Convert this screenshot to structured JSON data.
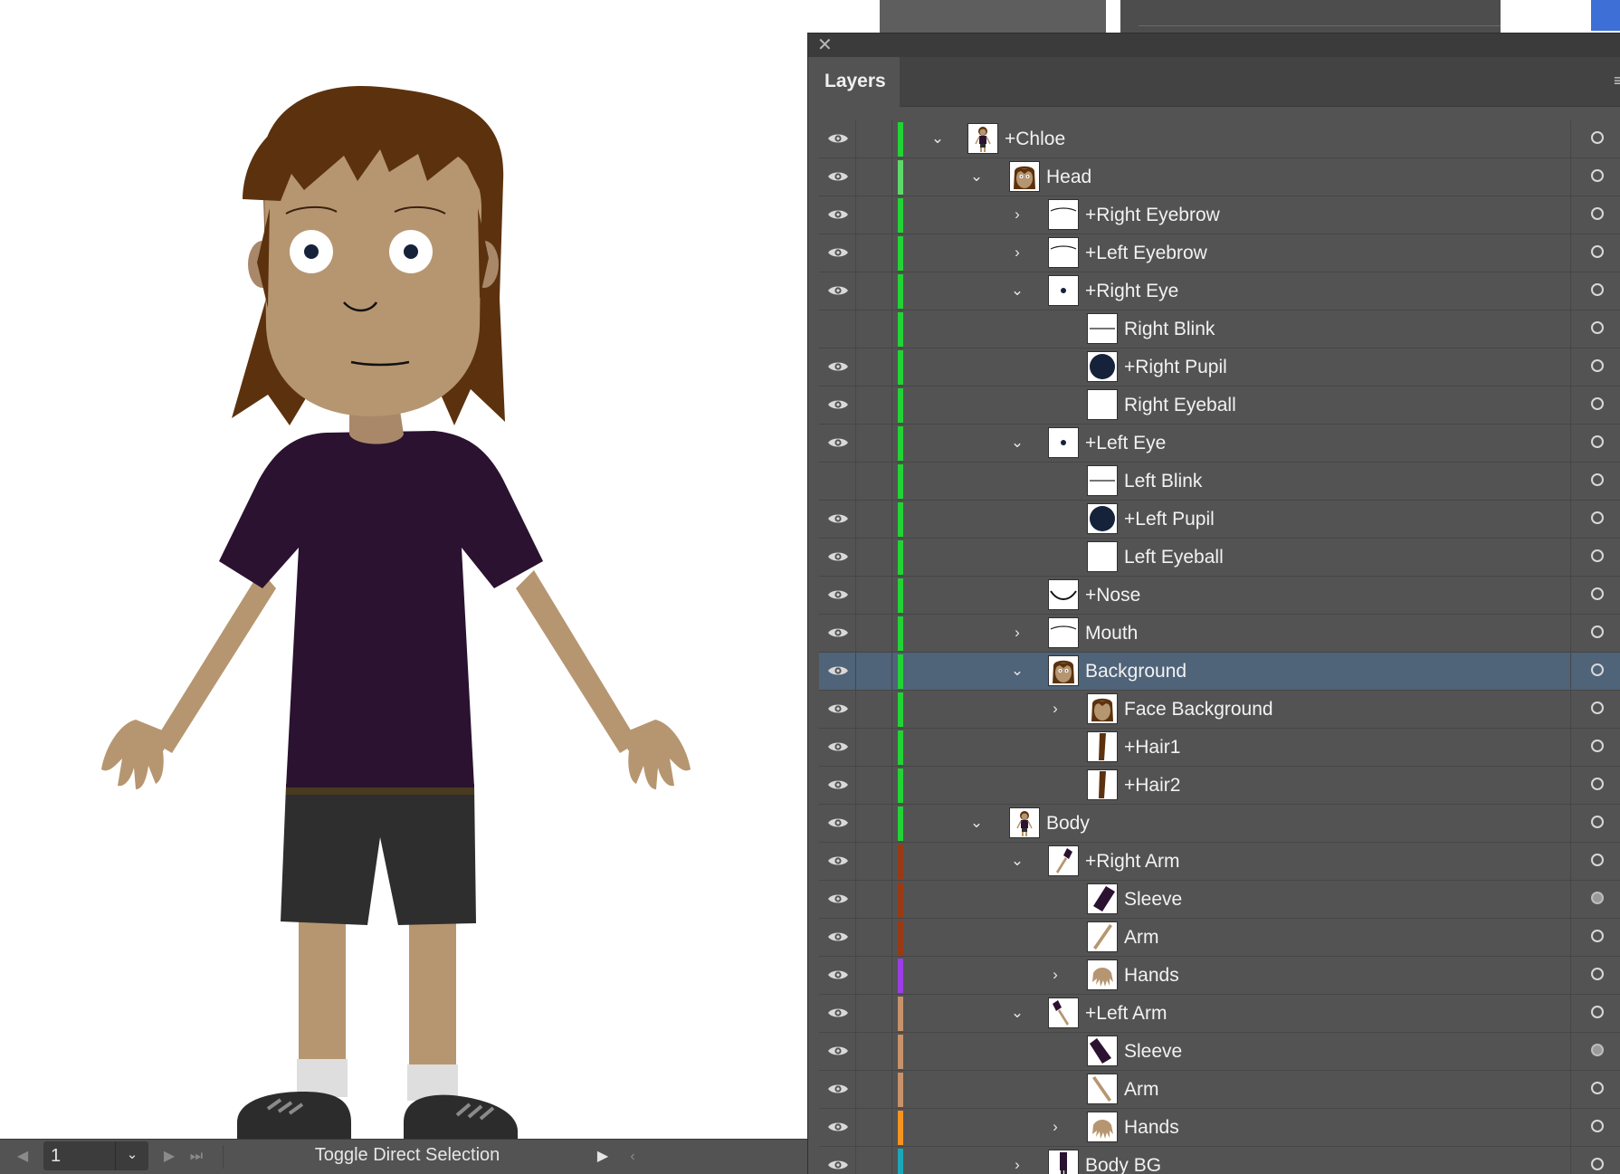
{
  "panel": {
    "tab_label": "Layers",
    "close_glyph": "✕",
    "menu_glyph": "≡"
  },
  "statusbar": {
    "artboard_number": "1",
    "current_tool": "Toggle Direct Selection"
  },
  "layers": [
    {
      "name": "+Chloe",
      "depth": 0,
      "twirl": "open",
      "visible": true,
      "color": "#22d334",
      "thumb": "chloe",
      "target": "empty"
    },
    {
      "name": "Head",
      "depth": 1,
      "twirl": "open",
      "visible": true,
      "color": "#5ed86a",
      "thumb": "head",
      "target": "empty"
    },
    {
      "name": "+Right Eyebrow",
      "depth": 2,
      "twirl": "closed",
      "visible": true,
      "color": "#22d334",
      "thumb": "brow",
      "target": "empty"
    },
    {
      "name": "+Left Eyebrow",
      "depth": 2,
      "twirl": "closed",
      "visible": true,
      "color": "#22d334",
      "thumb": "brow",
      "target": "empty"
    },
    {
      "name": "+Right Eye",
      "depth": 2,
      "twirl": "open",
      "visible": true,
      "color": "#22d334",
      "thumb": "eye",
      "target": "empty"
    },
    {
      "name": "Right Blink",
      "depth": 3,
      "twirl": "none",
      "visible": false,
      "color": "#22d334",
      "thumb": "line",
      "target": "empty"
    },
    {
      "name": "+Right Pupil",
      "depth": 3,
      "twirl": "none",
      "visible": true,
      "color": "#22d334",
      "thumb": "pupil",
      "target": "empty"
    },
    {
      "name": "Right Eyeball",
      "depth": 3,
      "twirl": "none",
      "visible": true,
      "color": "#22d334",
      "thumb": "blank",
      "target": "empty"
    },
    {
      "name": "+Left Eye",
      "depth": 2,
      "twirl": "open",
      "visible": true,
      "color": "#22d334",
      "thumb": "eye",
      "target": "empty"
    },
    {
      "name": "Left Blink",
      "depth": 3,
      "twirl": "none",
      "visible": false,
      "color": "#22d334",
      "thumb": "line",
      "target": "empty"
    },
    {
      "name": "+Left Pupil",
      "depth": 3,
      "twirl": "none",
      "visible": true,
      "color": "#22d334",
      "thumb": "pupil",
      "target": "empty"
    },
    {
      "name": "Left Eyeball",
      "depth": 3,
      "twirl": "none",
      "visible": true,
      "color": "#22d334",
      "thumb": "blank",
      "target": "empty"
    },
    {
      "name": "+Nose",
      "depth": 2,
      "twirl": "none",
      "visible": true,
      "color": "#22d334",
      "thumb": "nose",
      "target": "empty"
    },
    {
      "name": "Mouth",
      "depth": 2,
      "twirl": "closed",
      "visible": true,
      "color": "#22d334",
      "thumb": "brow",
      "target": "empty"
    },
    {
      "name": "Background",
      "depth": 2,
      "twirl": "open",
      "visible": true,
      "color": "#22d334",
      "thumb": "head",
      "target": "empty",
      "selected": true
    },
    {
      "name": "Face Background",
      "depth": 3,
      "twirl": "closed",
      "visible": true,
      "color": "#22d334",
      "thumb": "face",
      "target": "empty"
    },
    {
      "name": "+Hair1",
      "depth": 3,
      "twirl": "none",
      "visible": true,
      "color": "#22d334",
      "thumb": "hair",
      "target": "empty"
    },
    {
      "name": "+Hair2",
      "depth": 3,
      "twirl": "none",
      "visible": true,
      "color": "#22d334",
      "thumb": "hair",
      "target": "empty"
    },
    {
      "name": "Body",
      "depth": 1,
      "twirl": "open",
      "visible": true,
      "color": "#22d334",
      "thumb": "chloe",
      "target": "empty"
    },
    {
      "name": "+Right Arm",
      "depth": 2,
      "twirl": "open",
      "visible": true,
      "color": "#9a3a14",
      "thumb": "armfull",
      "target": "empty"
    },
    {
      "name": "Sleeve",
      "depth": 3,
      "twirl": "none",
      "visible": true,
      "color": "#9a3a14",
      "thumb": "sleeve",
      "target": "filled"
    },
    {
      "name": "Arm",
      "depth": 3,
      "twirl": "none",
      "visible": true,
      "color": "#9a3a14",
      "thumb": "arm",
      "target": "empty"
    },
    {
      "name": "Hands",
      "depth": 3,
      "twirl": "closed",
      "visible": true,
      "color": "#9b3ee6",
      "thumb": "hand",
      "target": "empty"
    },
    {
      "name": "+Left Arm",
      "depth": 2,
      "twirl": "open",
      "visible": true,
      "color": "#c8926a",
      "thumb": "armfull2",
      "target": "empty"
    },
    {
      "name": "Sleeve",
      "depth": 3,
      "twirl": "none",
      "visible": true,
      "color": "#c8926a",
      "thumb": "sleeve2",
      "target": "filled"
    },
    {
      "name": "Arm",
      "depth": 3,
      "twirl": "none",
      "visible": true,
      "color": "#c8926a",
      "thumb": "arm2",
      "target": "empty"
    },
    {
      "name": "Hands",
      "depth": 3,
      "twirl": "closed",
      "visible": true,
      "color": "#f5941e",
      "thumb": "hand",
      "target": "empty"
    },
    {
      "name": "Body BG",
      "depth": 2,
      "twirl": "closed",
      "visible": true,
      "color": "#1aa7b8",
      "thumb": "bodybg",
      "target": "empty"
    }
  ],
  "colors": {
    "panel_bg": "#535353",
    "selected_row": "#4f6379",
    "skin": "#b69670",
    "hair": "#5c320e",
    "shirt": "#2a1230",
    "shorts": "#2e2e2e"
  },
  "icons": {
    "visibility": "eye-icon",
    "expand": "chevron-right-icon",
    "collapse": "chevron-down-icon",
    "target": "target-circle-icon"
  }
}
